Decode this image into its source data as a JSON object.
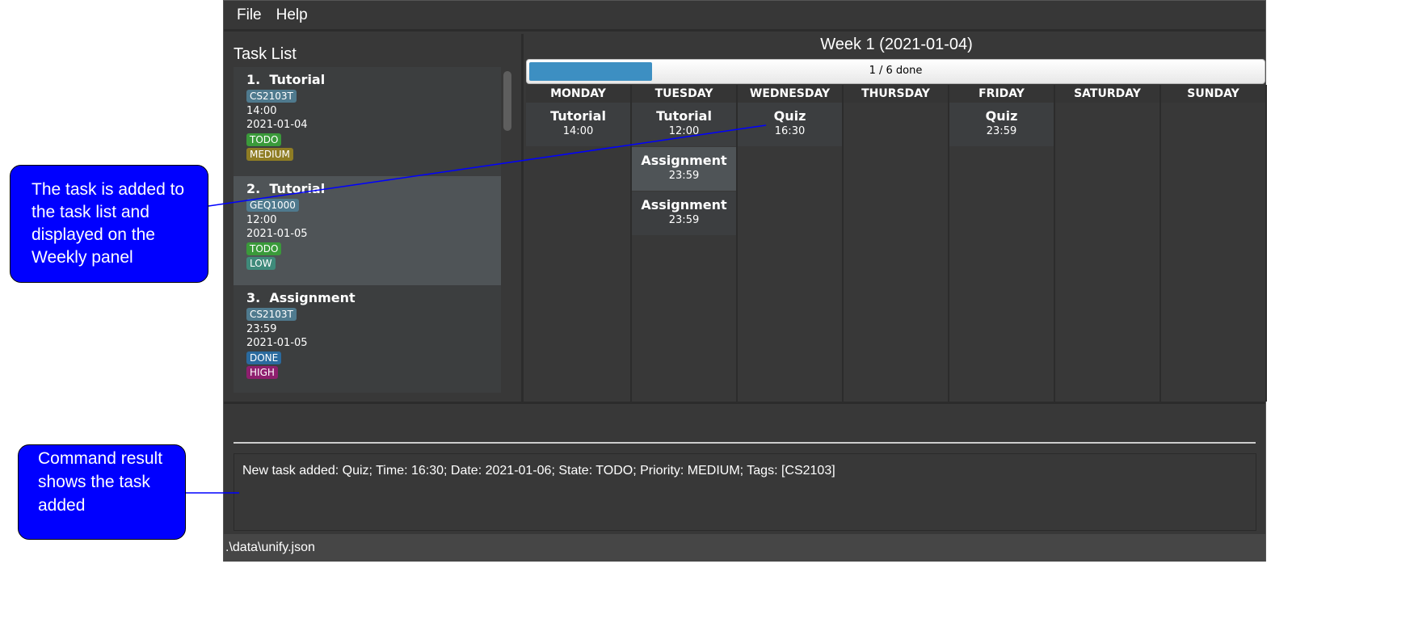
{
  "menu": {
    "items": [
      "File",
      "Help"
    ]
  },
  "task_list": {
    "title": "Task List",
    "tasks": [
      {
        "index": "1.",
        "name": "Tutorial",
        "tag": "CS2103T",
        "time": "14:00",
        "date": "2021-01-04",
        "state": "TODO",
        "priority": "MEDIUM",
        "selected": false
      },
      {
        "index": "2.",
        "name": "Tutorial",
        "tag": "GEQ1000",
        "time": "12:00",
        "date": "2021-01-05",
        "state": "TODO",
        "priority": "LOW",
        "selected": true
      },
      {
        "index": "3.",
        "name": "Assignment",
        "tag": "CS2103T",
        "time": "23:59",
        "date": "2021-01-05",
        "state": "DONE",
        "priority": "HIGH",
        "selected": false
      }
    ]
  },
  "weekly": {
    "title": "Week 1 (2021-01-04)",
    "progress": {
      "label": "1 / 6 done",
      "fraction": 0.1667
    },
    "days": [
      {
        "name": "MONDAY",
        "events": [
          {
            "name": "Tutorial",
            "time": "14:00"
          }
        ]
      },
      {
        "name": "TUESDAY",
        "events": [
          {
            "name": "Tutorial",
            "time": "12:00"
          },
          {
            "name": "Assignment",
            "time": "23:59"
          },
          {
            "name": "Assignment",
            "time": "23:59"
          }
        ]
      },
      {
        "name": "WEDNESDAY",
        "events": [
          {
            "name": "Quiz",
            "time": "16:30"
          }
        ]
      },
      {
        "name": "THURSDAY",
        "events": []
      },
      {
        "name": "FRIDAY",
        "events": [
          {
            "name": "Quiz",
            "time": "23:59"
          }
        ]
      },
      {
        "name": "SATURDAY",
        "events": []
      },
      {
        "name": "SUNDAY",
        "events": []
      }
    ]
  },
  "command": {
    "value": ""
  },
  "result": "New task added: Quiz; Time: 16:30; Date: 2021-01-06; State: TODO; Priority: MEDIUM; Tags: [CS2103]",
  "status": ".\\data\\unify.json",
  "annotations": [
    "The task is added to the task list and displayed on the Weekly panel",
    "Command result shows the task added"
  ],
  "colors": {
    "tag": "#4f7a8e",
    "TODO": "#3a9a3a",
    "DONE": "#2a6a9e",
    "MEDIUM": "#8f7d24",
    "LOW": "#3f8a7a",
    "HIGH": "#8e1f6e",
    "progress": "#3d8fc2",
    "callout": "#0000ff"
  }
}
